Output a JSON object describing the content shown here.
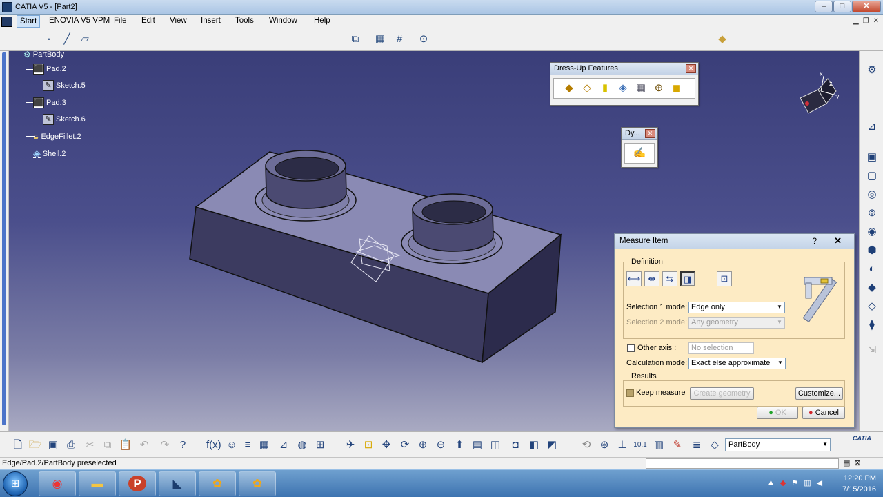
{
  "window": {
    "title": "CATIA V5 - [Part2]"
  },
  "menu": {
    "start": "Start",
    "items": [
      "ENOVIA V5 VPM",
      "File",
      "Edit",
      "View",
      "Insert",
      "Tools",
      "Window",
      "Help"
    ]
  },
  "tree": {
    "root": "PartBody",
    "nodes": [
      "Pad.2",
      "Sketch.5",
      "Pad.3",
      "Sketch.6",
      "EdgeFillet.2",
      "Shell.2"
    ]
  },
  "dressup_toolbar": {
    "title": "Dress-Up Features"
  },
  "dy_toolbar": {
    "title": "Dy..."
  },
  "measure_dialog": {
    "title": "Measure Item",
    "help": "?",
    "close": "✕",
    "definition_label": "Definition",
    "selection1_label": "Selection 1 mode:",
    "selection1_value": "Edge only",
    "selection2_label": "Selection 2 mode:",
    "selection2_value": "Any geometry",
    "other_axis_label": "Other axis :",
    "other_axis_value": "No selection",
    "calc_mode_label": "Calculation mode:",
    "calc_mode_value": "Exact else approximate",
    "results_label": "Results",
    "keep_measure_label": "Keep measure",
    "keep_measure_checked": true,
    "create_geometry_label": "Create geometry",
    "customize_label": "Customize...",
    "ok_label": "OK",
    "cancel_label": "Cancel"
  },
  "bottom_toolbar": {
    "current_body": "PartBody",
    "logo": "CATIA"
  },
  "status": {
    "message": "Edge/Pad.2/PartBody preselected"
  },
  "taskbar": {
    "time": "12:20 PM",
    "date": "7/15/2016"
  },
  "colors": {
    "viewport_top": "#3a3e79",
    "viewport_bottom": "#a9aac2",
    "dialog_bg": "#fdebc4",
    "part_top": "#8a8ab4",
    "part_side": "#3c3b60"
  }
}
